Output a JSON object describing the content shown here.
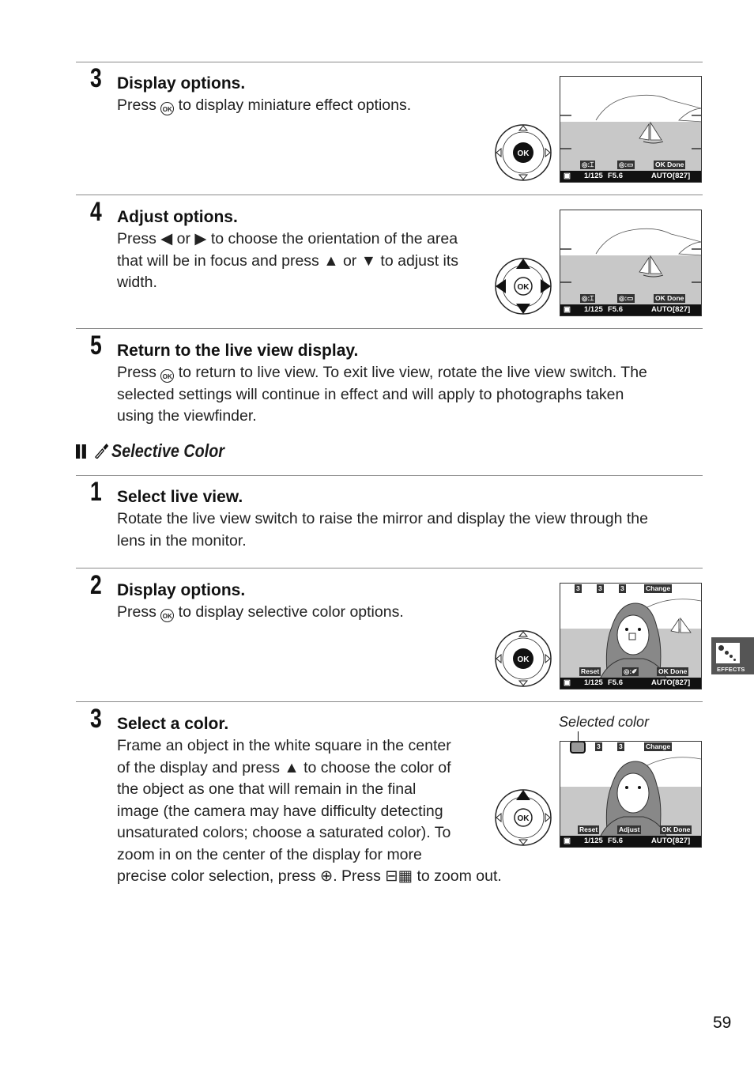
{
  "miniature_steps": [
    {
      "number": "3",
      "title": "Display options.",
      "body_parts": [
        "Press ",
        "ok-button",
        " to display miniature effect options."
      ],
      "text": "Press [OK] to display miniature effect options.",
      "screen": {
        "bottom_chips": [
          "◎:⌶",
          "◎:▭",
          "OK Done"
        ],
        "status": {
          "shutter": "1/125",
          "aperture": "F5.6",
          "iso": "AUTO",
          "shots": "[827]"
        }
      },
      "dial_highlight": "none"
    },
    {
      "number": "4",
      "title": "Adjust options.",
      "lines": [
        "Press ◀ or ▶ to choose the orientation of the area",
        "that will be in focus and press ▲ or ▼ to adjust its",
        "width."
      ],
      "screen": {
        "bottom_chips": [
          "◎:⌶",
          "◎:▭",
          "OK Done"
        ],
        "status": {
          "shutter": "1/125",
          "aperture": "F5.6",
          "iso": "AUTO",
          "shots": "[827]"
        }
      },
      "dial_highlight": "all-directions"
    },
    {
      "number": "5",
      "title": "Return to the live view display.",
      "lines": [
        "to return to live view.  To exit live view, rotate the live view switch. The",
        "selected settings will continue in effect and will apply to photographs taken",
        "using the viewfinder."
      ],
      "press": "Press "
    }
  ],
  "section": {
    "title": "Selective Color",
    "icon": "eyedropper-icon"
  },
  "selective_steps": [
    {
      "number": "1",
      "title": "Select live view.",
      "lines": [
        "Rotate the live view switch to raise the mirror and display the view through the",
        "lens in the monitor."
      ]
    },
    {
      "number": "2",
      "title": "Display options.",
      "press": "Press ",
      "rest": " to display selective color options.",
      "screen": {
        "top_chips": [
          "3",
          "3",
          "3",
          "Change"
        ],
        "bottom_chips": [
          "Reset",
          "◎:✐",
          "OK Done"
        ],
        "status": {
          "shutter": "1/125",
          "aperture": "F5.6",
          "iso": "AUTO",
          "shots": "[827]"
        }
      },
      "dial_highlight": "none"
    },
    {
      "number": "3",
      "title": "Select a color.",
      "lines": [
        "Frame an object in the white square in the center",
        "of the display and press ▲ to choose the color of",
        "the object as one that will remain in the final",
        "image (the camera may have difficulty detecting",
        "unsaturated colors; choose a saturated color).  To",
        "zoom in on the center of the display for more",
        "precise color selection, press ⊕.  Press ⊟▦ to zoom out."
      ],
      "callout": "Selected color",
      "screen": {
        "top_chips": [
          "3",
          "3",
          "Change"
        ],
        "bottom_chips": [
          "Reset",
          "Adjust",
          "OK Done"
        ],
        "status": {
          "shutter": "1/125",
          "aperture": "F5.6",
          "iso": "AUTO",
          "shots": "[827]"
        }
      },
      "dial_highlight": "up"
    }
  ],
  "side_tab": {
    "label": "EFFECTS",
    "icon": "effects-icon"
  },
  "page_number": "59",
  "ok_glyph": "OK"
}
